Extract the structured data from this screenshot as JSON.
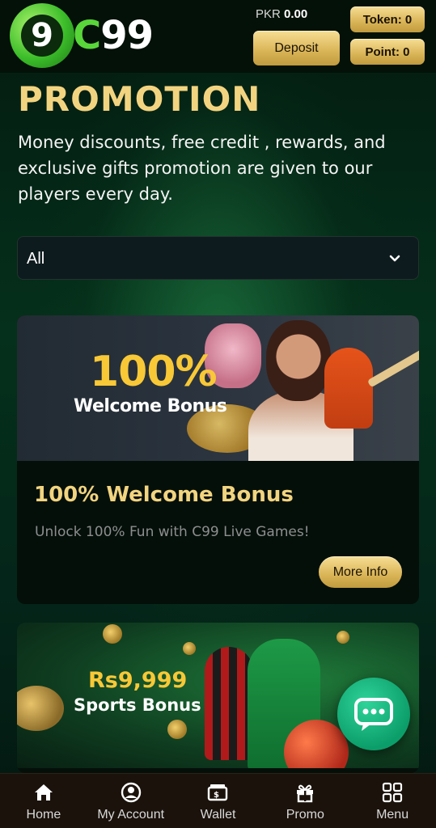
{
  "header": {
    "logo_text": "C99",
    "logo_mark": "9",
    "balance_currency": "PKR",
    "balance_value": "0.00",
    "deposit_label": "Deposit",
    "token_label": "Token: 0",
    "point_label": "Point: 0"
  },
  "promotion": {
    "title": "PROMOTION",
    "description": "Money discounts, free credit , rewards, and exclusive gifts promotion are given to our players every day."
  },
  "filter": {
    "selected": "All",
    "icon": "chevron-down-icon"
  },
  "cards": [
    {
      "banner_headline": "100%",
      "banner_subline": "Welcome Bonus",
      "title": "100% Welcome Bonus",
      "text": "Unlock 100% Fun with C99 Live Games!",
      "button_label": "More Info"
    },
    {
      "banner_headline": "Rs9,999",
      "banner_subline": "Sports Bonus"
    }
  ],
  "chat": {
    "icon": "chat-bubble-icon"
  },
  "nav": {
    "items": [
      {
        "label": "Home",
        "icon": "home-icon"
      },
      {
        "label": "My Account",
        "icon": "user-icon"
      },
      {
        "label": "Wallet",
        "icon": "wallet-icon"
      },
      {
        "label": "Promo",
        "icon": "gift-icon"
      },
      {
        "label": "Menu",
        "icon": "grid-icon"
      }
    ]
  },
  "colors": {
    "accent_gold": "#f2d480",
    "button_gold": "#d9b456",
    "logo_green": "#59d63a",
    "chat_green": "#0c9e6a",
    "background": "#041a10"
  }
}
